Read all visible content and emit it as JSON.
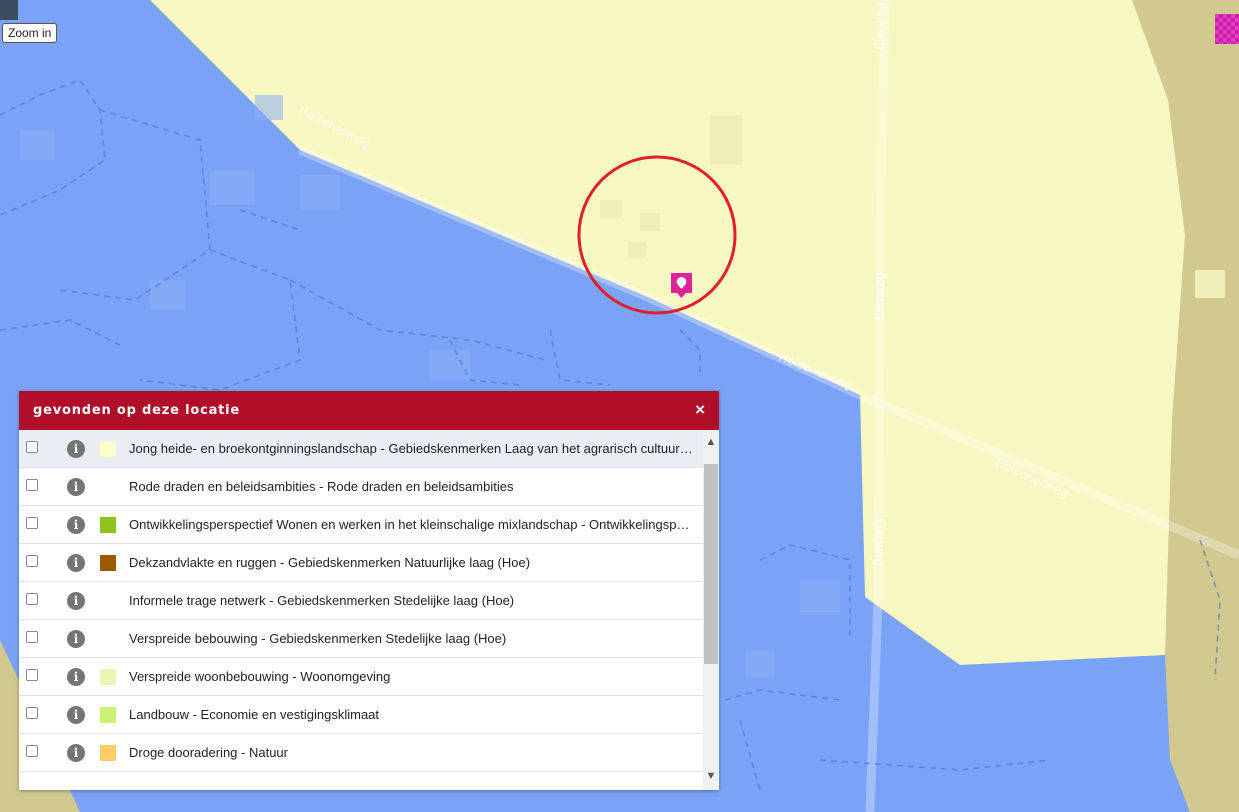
{
  "map": {
    "tooltip": "Zoom in",
    "street_labels": [
      "Holsenerweg",
      "Holsenerweg",
      "Holsenerweg",
      "Elerweg",
      "Elerweg",
      "Elerweg"
    ],
    "colors": {
      "blue_zone": "#7aa3f8",
      "yellow_zone": "#f7f7c2",
      "olive_zone": "#d2c990",
      "circle": "#e01f26",
      "marker": "#e0229a"
    }
  },
  "panel": {
    "title": "gevonden op deze locatie",
    "close_icon": "×",
    "info_glyph": "i",
    "scroll_up_glyph": "▲",
    "scroll_down_glyph": "▼",
    "items": [
      {
        "label": "Jong heide- en broekontginningslandschap - Gebiedskenmerken Laag van het agrarisch cultuurlandschap (Hoe)",
        "swatch": "#ffffcc",
        "selected": true
      },
      {
        "label": "Rode draden en beleidsambities - Rode draden en beleidsambities",
        "swatch": ""
      },
      {
        "label": "Ontwikkelingsperspectief Wonen en werken in het kleinschalige mixlandschap - Ontwikkelingsperspectieven",
        "swatch": "#8fc31f"
      },
      {
        "label": "Dekzandvlakte en ruggen - Gebiedskenmerken Natuurlijke laag (Hoe)",
        "swatch": "#9c5a00"
      },
      {
        "label": "Informele trage netwerk - Gebiedskenmerken Stedelijke laag (Hoe)",
        "swatch": ""
      },
      {
        "label": "Verspreide bebouwing - Gebiedskenmerken Stedelijke laag (Hoe)",
        "swatch": ""
      },
      {
        "label": "Verspreide woonbebouwing - Woonomgeving",
        "swatch": "#eaf5b3"
      },
      {
        "label": "Landbouw - Economie en vestigingsklimaat",
        "swatch": "#c9f271"
      },
      {
        "label": "Droge dooradering - Natuur",
        "swatch": "#ffcc66"
      }
    ]
  }
}
